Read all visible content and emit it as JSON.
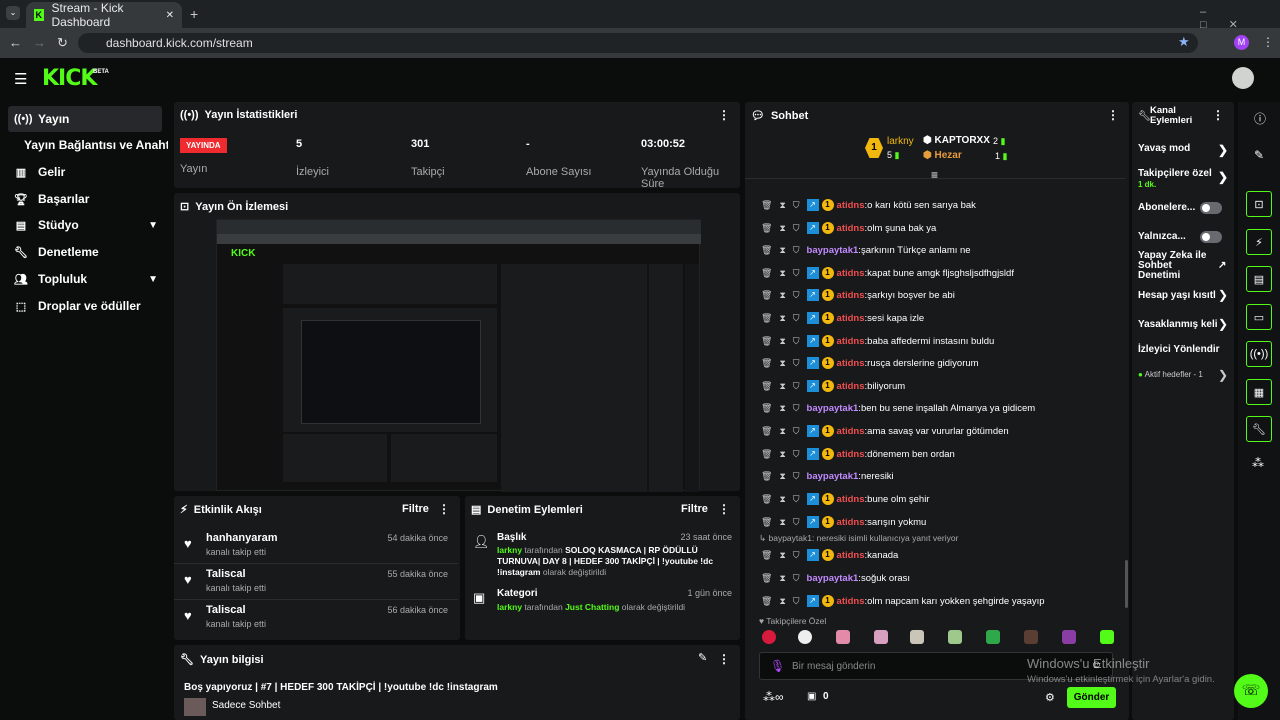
{
  "browser": {
    "tab_title": "Stream - Kick Dashboard",
    "url": "dashboard.kick.com/stream",
    "profile_letter": "M"
  },
  "brand": {
    "logo": "KICK",
    "beta": "BETA"
  },
  "sidebar": {
    "items": [
      {
        "label": "Yayın"
      },
      {
        "label": "Yayın Bağlantısı ve Anahtarı"
      },
      {
        "label": "Gelir"
      },
      {
        "label": "Başarılar"
      },
      {
        "label": "Stüdyo"
      },
      {
        "label": "Denetleme"
      },
      {
        "label": "Topluluk"
      },
      {
        "label": "Droplar ve ödüller"
      }
    ]
  },
  "stats": {
    "title": "Yayın İstatistikleri",
    "live_badge": "YAYINDA",
    "live_label": "Yayın",
    "viewers": "5",
    "viewers_label": "İzleyici",
    "followers": "301",
    "followers_label": "Takipçi",
    "subs": "-",
    "subs_label": "Abone Sayısı",
    "duration": "03:00:52",
    "duration_label": "Yayında Olduğu Süre"
  },
  "preview": {
    "title": "Yayın Ön İzlemesi"
  },
  "activity": {
    "title": "Etkinlik Akışı",
    "filter": "Filtre",
    "events": [
      {
        "name": "hanhanyaram",
        "sub": "kanalı takip etti",
        "time": "54 dakika önce"
      },
      {
        "name": "Taliscal",
        "sub": "kanalı takip etti",
        "time": "55 dakika önce"
      },
      {
        "name": "Taliscal",
        "sub": "kanalı takip etti",
        "time": "56 dakika önce"
      }
    ]
  },
  "moderation": {
    "title": "Denetim Eylemleri",
    "filter": "Filtre",
    "items": [
      {
        "title": "Başlık",
        "time": "23 saat önce",
        "user": "larkny",
        "by": "tarafından",
        "value": "SOLOQ KASMACA | RP ÖDÜLLÜ TURNUVA| DAY 8 | HEDEF 300 TAKİPÇİ | !youtube !dc !instagram",
        "suffix": "olarak değiştirildi"
      },
      {
        "title": "Kategori",
        "time": "1 gün önce",
        "user": "larkny",
        "by": "tarafından",
        "value": "Just Chatting",
        "suffix": "olarak değiştirildi"
      }
    ]
  },
  "info": {
    "title": "Yayın bilgisi",
    "stream_title": "Boş yapıyoruz | #7 | HEDEF 300 TAKİPÇİ | !youtube !dc !instagram",
    "category": "Sadece Sohbet"
  },
  "chat": {
    "title": "Sohbet",
    "leaders": {
      "first": "larkny",
      "first_count": "5",
      "second": "KAPTORXX",
      "second_count": "2",
      "third": "Hezar",
      "third_count": "1",
      "rank": "1"
    },
    "messages": [
      {
        "user": "atidns",
        "color": "red",
        "text": "o karı kötü sen sarıya bak"
      },
      {
        "user": "atidns",
        "color": "red",
        "text": "olm şuna bak ya"
      },
      {
        "user": "baypaytak1",
        "color": "pur",
        "text": "şarkının Türkçe anlamı ne"
      },
      {
        "user": "atidns",
        "color": "red",
        "text": "kapat bune amgk fljsghsljsdfhgjsldf"
      },
      {
        "user": "atidns",
        "color": "red",
        "text": "şarkıyı boşver be abi"
      },
      {
        "user": "atidns",
        "color": "red",
        "text": "sesi kapa izle"
      },
      {
        "user": "atidns",
        "color": "red",
        "text": "baba affedermi instasını buldu"
      },
      {
        "user": "atidns",
        "color": "red",
        "text": "rusça derslerine gidiyorum"
      },
      {
        "user": "atidns",
        "color": "red",
        "text": "biliyorum"
      },
      {
        "user": "baypaytak1",
        "color": "pur",
        "text": "ben bu sene inşallah Almanya ya gidicem"
      },
      {
        "user": "atidns",
        "color": "red",
        "text": "ama savaş var vururlar götümden"
      },
      {
        "user": "atidns",
        "color": "red",
        "text": "dönemem ben ordan"
      },
      {
        "user": "baypaytak1",
        "color": "pur",
        "text": "neresiki"
      },
      {
        "user": "atidns",
        "color": "red",
        "text": "bune olm şehir"
      },
      {
        "user": "atidns",
        "color": "red",
        "text": "sarışın yokmu"
      },
      {
        "user": "atidns",
        "color": "red",
        "text": "kanada"
      },
      {
        "user": "baypaytak1",
        "color": "pur",
        "text": "soğuk orası"
      },
      {
        "user": "atidns",
        "color": "red",
        "text": "olm napcam karı yokken şehgirde yaşayıp"
      }
    ],
    "reply_note": "baypaytak1: neresiki isimli kullanıcıya yanıt veriyor",
    "emote_label": "Takipçilere Özel",
    "placeholder": "Bir mesaj gönderin",
    "count": "0",
    "send": "Gönder"
  },
  "channel": {
    "title": "Kanal Eylemleri",
    "slow": "Yavaş mod",
    "followers_only": "Takipçilere özel",
    "followers_only_sub": "1 dk.",
    "subs": "Abonelere...",
    "only": "Yalnızca...",
    "ai": "Yapay Zeka ile Sohbet Denetimi",
    "age": "Hesap yaşı kısıtl",
    "banned": "Yasaklanmış keli",
    "viewer": "İzleyici Yönlendir",
    "goals": "Aktif hedefler - 1"
  },
  "windows": {
    "line1": "Windows'u Etkinleştir",
    "line2": "Windows'u etkinleştirmek için Ayarlar'a gidin."
  },
  "colors": {
    "accent": "#53fc18",
    "live": "#ef2b2f"
  }
}
